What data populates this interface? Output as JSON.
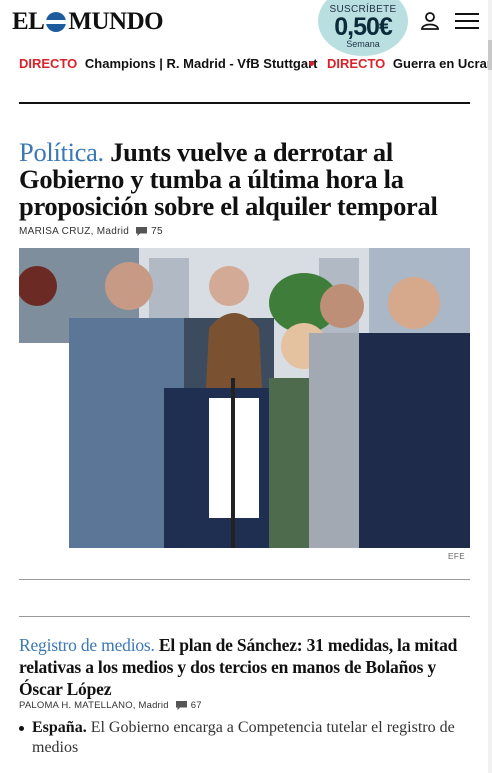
{
  "header": {
    "logo_text_left": "EL",
    "logo_text_right": "MUNDO",
    "promo": {
      "kicker": "SUSCRÍBETE",
      "price": "0,50€",
      "period": "Semana"
    }
  },
  "ticker": [
    {
      "live": "DIRECTO",
      "text": "Champions | R. Madrid - VfB Stuttgart"
    },
    {
      "live": "DIRECTO",
      "text": "Guerra en Ucrania"
    }
  ],
  "lead": {
    "section": "Política.",
    "headline": "Junts vuelve a derrotar al Gobierno y tumba a última hora la proposición sobre el alquiler temporal",
    "author": "MARISA CRUZ",
    "location": ", Madrid",
    "comments": "75",
    "image_credit": "EFE"
  },
  "second": {
    "section": "Registro de medios.",
    "headline": "El plan de Sánchez: 31 medidas, la mitad relativas a los medios y dos tercios en manos de Bolaños y Óscar López",
    "author": "PALOMA H. MATELLANO",
    "location": " , Madrid",
    "comments": "67"
  },
  "related": {
    "section": "España.",
    "text": "El Gobierno encarga a Competencia tutelar el registro de medios"
  },
  "colors": {
    "accent_blue": "#3a78b6",
    "live_red": "#d8232a",
    "promo_bg": "#b9dfe0"
  },
  "icons": [
    "globe-icon",
    "user-icon",
    "menu-icon",
    "comment-icon"
  ]
}
